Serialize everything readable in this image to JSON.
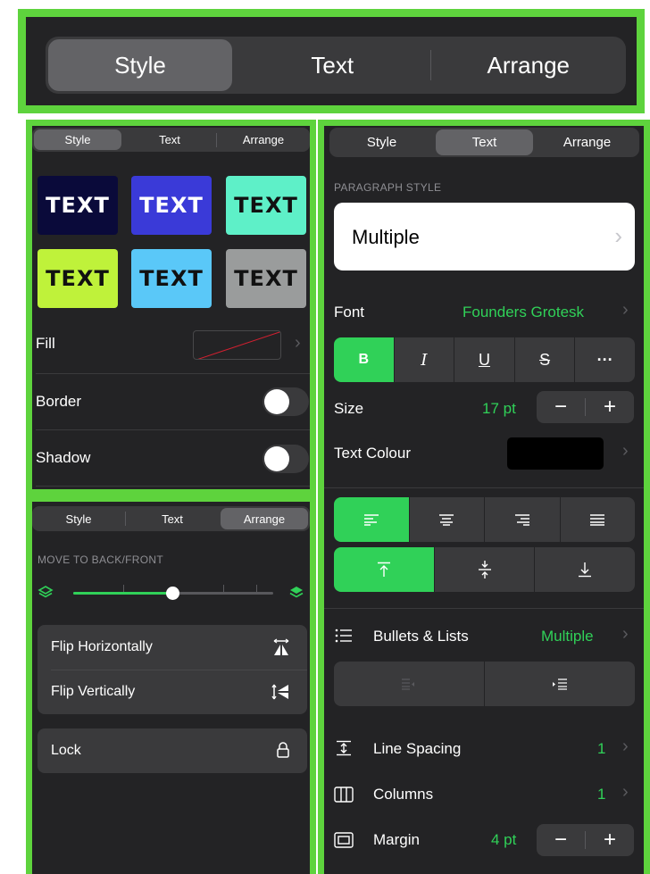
{
  "top_tabs": {
    "style": "Style",
    "text": "Text",
    "arrange": "Arrange"
  },
  "left_top": {
    "tabs": {
      "style": "Style",
      "text": "Text",
      "arrange": "Arrange"
    },
    "tile_text": "TEXT",
    "tiles": [
      {
        "bg": "#0a0a3a",
        "fg": "#ffffff"
      },
      {
        "bg": "#3a3ad8",
        "fg": "#ffffff"
      },
      {
        "bg": "#5ef0c8",
        "fg": "#111111"
      },
      {
        "bg": "#bff23a",
        "fg": "#111111"
      },
      {
        "bg": "#5ac8f8",
        "fg": "#111111"
      },
      {
        "bg": "#9a9c9c",
        "fg": "#111111"
      }
    ],
    "fill_label": "Fill",
    "border_label": "Border",
    "shadow_label": "Shadow"
  },
  "left_bottom": {
    "tabs": {
      "style": "Style",
      "text": "Text",
      "arrange": "Arrange"
    },
    "move_label": "MOVE TO BACK/FRONT",
    "slider_value_fraction": 0.5,
    "flip_h": "Flip Horizontally",
    "flip_v": "Flip Vertically",
    "lock": "Lock"
  },
  "right": {
    "tabs": {
      "style": "Style",
      "text": "Text",
      "arrange": "Arrange"
    },
    "paragraph_style_label": "PARAGRAPH STYLE",
    "paragraph_style_value": "Multiple",
    "font_label": "Font",
    "font_value": "Founders Grotesk",
    "format_buttons": {
      "bold": "B",
      "italic": "I",
      "underline": "U",
      "strike": "S",
      "more": "···"
    },
    "size_label": "Size",
    "size_value": "17 pt",
    "text_colour_label": "Text Colour",
    "text_colour": "#000000",
    "bullets_label": "Bullets & Lists",
    "bullets_value": "Multiple",
    "line_spacing_label": "Line Spacing",
    "line_spacing_value": "1",
    "columns_label": "Columns",
    "columns_value": "1",
    "margin_label": "Margin",
    "margin_value": "4 pt",
    "minus": "−",
    "plus": "+"
  },
  "colors": {
    "accent": "#30d158",
    "frame": "#5ed33d",
    "panel": "#232325"
  }
}
